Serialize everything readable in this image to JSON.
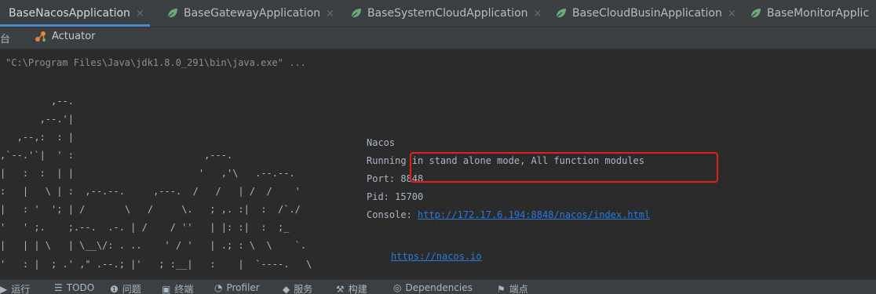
{
  "tabs": [
    {
      "label": "BaseNacosApplication",
      "active": true
    },
    {
      "label": "BaseGatewayApplication",
      "active": false
    },
    {
      "label": "BaseSystemCloudApplication",
      "active": false
    },
    {
      "label": "BaseCloudBusinApplication",
      "active": false
    },
    {
      "label": "BaseMonitorApplic",
      "active": false
    }
  ],
  "close_glyph": "×",
  "toolbar": {
    "left_label": "台",
    "actuator_label": "Actuator"
  },
  "console": {
    "command": "\"C:\\Program Files\\Java\\jdk1.8.0_291\\bin\\java.exe\" ...",
    "ascii_lines": [
      "         ,--.",
      "       ,--.'|",
      "   ,--,:  : |",
      ",`--.'`|  ' :                       ,---.",
      "|   :  :  | |                      '   ,'\\   .--.--.",
      ":   |   \\ | :  ,--.--.     ,---.  /   /   | /  /    '",
      "|   : '  '; | /       \\   /     \\.   ; ,. :|  :  /`./",
      "'   ' ;.    ;.--.  .-. | /    / ''   | |: :|  :  ;_",
      "|   | | \\   | \\__\\/: . ..    ' / '   | .; : \\  \\    `.",
      "'   : |  ; .' ,\" .--.; |'   ; :__|   :    |  `----.   \\"
    ],
    "nacos_title": "Nacos",
    "mode_line": "Running in stand alone mode, All function modules",
    "port_line": "Port: 8848",
    "pid_line": "Pid: 15700",
    "console_prefix": "Console: ",
    "console_url": "http://172.17.6.194:8848/nacos/index.html",
    "site_url": "https://nacos.io"
  },
  "bottom": [
    {
      "icon": "run-icon",
      "glyph": "▶",
      "label": "运行"
    },
    {
      "icon": "todo-icon",
      "glyph": "☰",
      "label": "TODO"
    },
    {
      "icon": "problems-icon",
      "glyph": "❶",
      "label": "问题"
    },
    {
      "icon": "terminal-icon",
      "glyph": "▣",
      "label": "终端"
    },
    {
      "icon": "profiler-icon",
      "glyph": "◔",
      "label": "Profiler"
    },
    {
      "icon": "services-icon",
      "glyph": "◆",
      "label": "服务"
    },
    {
      "icon": "build-icon",
      "glyph": "⚒",
      "label": "构建"
    },
    {
      "icon": "dependencies-icon",
      "glyph": "◎",
      "label": "Dependencies"
    },
    {
      "icon": "endpoints-icon",
      "glyph": "⚑",
      "label": "端点"
    }
  ],
  "colors": {
    "accent": "#4a88c7",
    "link": "#287bde",
    "highlight": "#e0201c",
    "leaf": "#6aab73"
  }
}
